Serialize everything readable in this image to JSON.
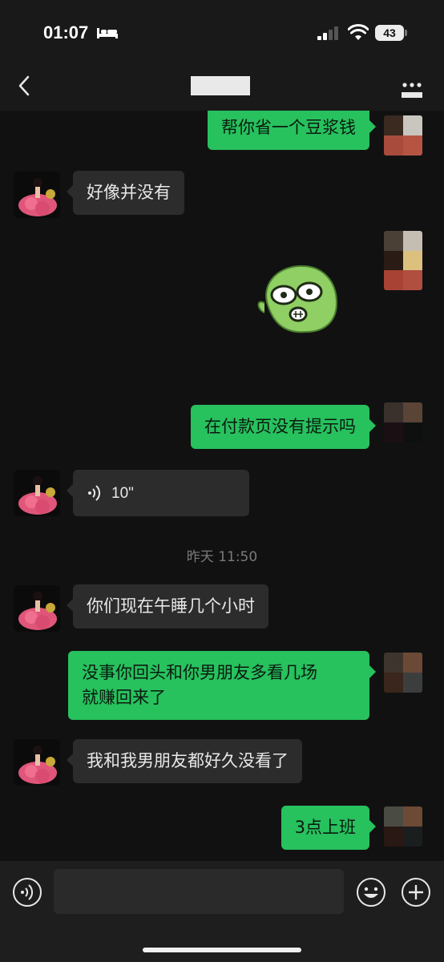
{
  "status_bar": {
    "time": "01:07",
    "battery": "43",
    "sleep_icon": "bed-icon",
    "signal_icon": "cellular-signal-icon",
    "wifi_icon": "wifi-icon"
  },
  "nav": {
    "back_icon": "chevron-left-icon",
    "title": "",
    "more_icon": "more-dots-icon"
  },
  "messages": [
    {
      "side": "out",
      "type": "text",
      "text": "帮你省一个豆浆钱"
    },
    {
      "side": "in",
      "type": "text",
      "text": "好像并没有"
    },
    {
      "side": "out",
      "type": "sticker",
      "sticker": "green-blob-shocked-sticker"
    },
    {
      "side": "out",
      "type": "text",
      "text": "在付款页没有提示吗"
    },
    {
      "side": "in",
      "type": "voice",
      "duration": "10\""
    },
    {
      "type": "timestamp",
      "text": "昨天 11:50"
    },
    {
      "side": "in",
      "type": "text",
      "text": "你们现在午睡几个小时"
    },
    {
      "side": "out",
      "type": "text",
      "lines": [
        "没事你回头和你男朋友多看几场",
        "就赚回来了"
      ]
    },
    {
      "side": "in",
      "type": "text",
      "text": "我和我男朋友都好久没看了"
    },
    {
      "side": "out",
      "type": "text",
      "text": "3点上班"
    }
  ],
  "input_bar": {
    "voice_icon": "voice-input-icon",
    "placeholder": "",
    "emoji_icon": "emoji-icon",
    "plus_icon": "plus-circle-icon"
  },
  "colors": {
    "outgoing_bubble": "#27c15e",
    "incoming_bubble": "#2c2c2c",
    "background": "#111111"
  }
}
